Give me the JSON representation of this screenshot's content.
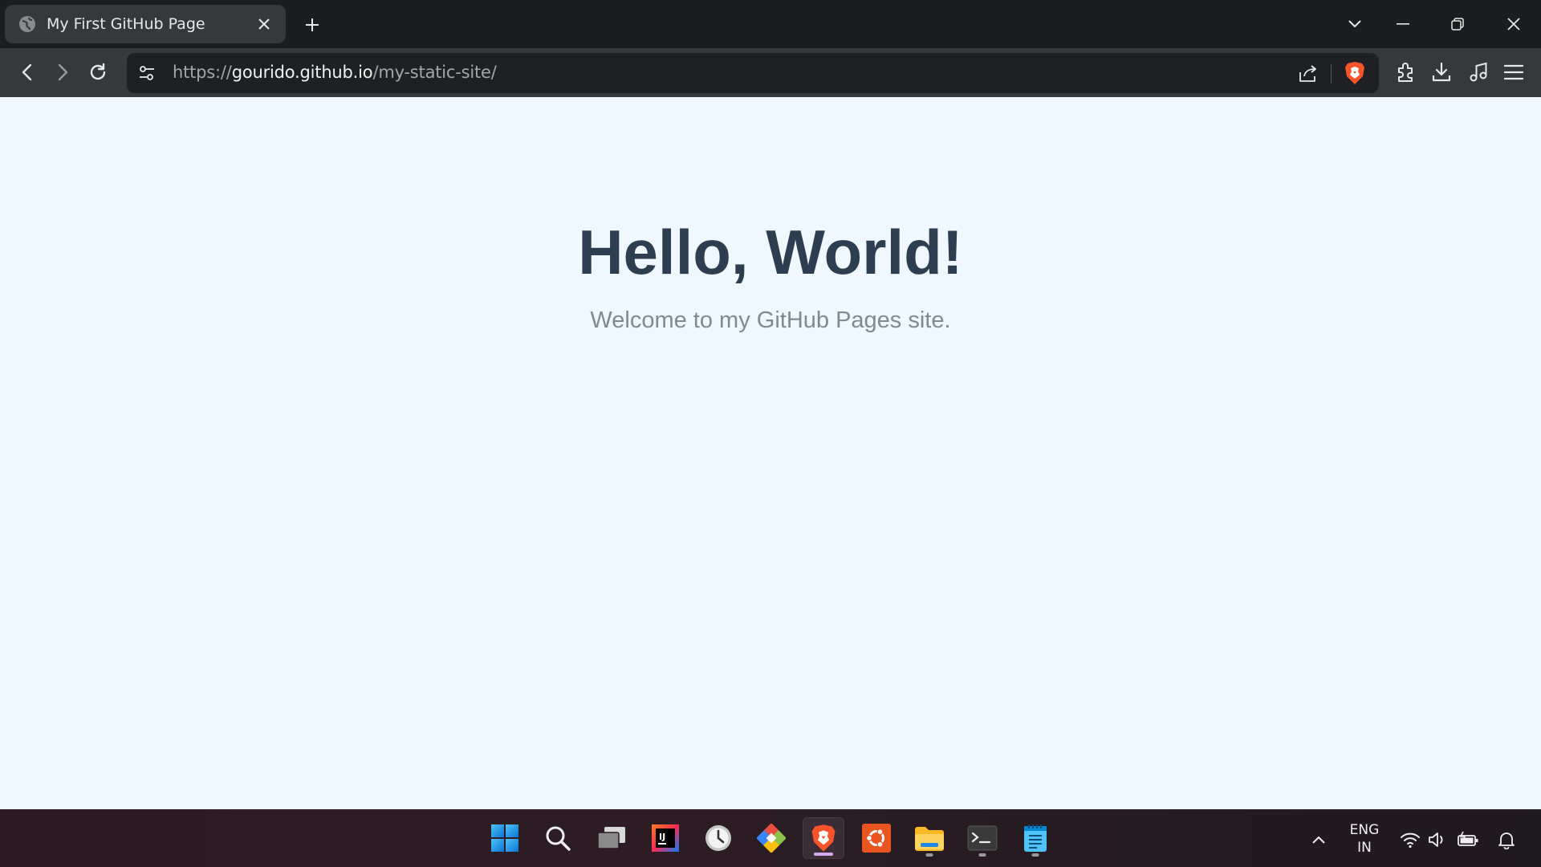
{
  "browser": {
    "tab": {
      "title": "My First GitHub Page",
      "favicon": "globe-icon",
      "close_icon": "close-icon"
    },
    "new_tab_icon": "plus-icon",
    "window_controls": [
      "tab-search-chevron-icon",
      "minimize-icon",
      "restore-icon",
      "close-icon"
    ],
    "address": {
      "scheme": "https://",
      "host": "gourido.github.io",
      "path": "/my-static-site/"
    },
    "toolbar_icons": [
      "back-icon",
      "forward-icon",
      "reload-icon",
      "site-settings-icon",
      "share-icon",
      "brave-shields-icon",
      "extensions-icon",
      "downloads-icon",
      "media-icon",
      "menu-icon"
    ]
  },
  "page": {
    "heading": "Hello, World!",
    "subtitle": "Welcome to my GitHub Pages site.",
    "background": "#eff8fe",
    "heading_color": "#2c3e50",
    "subtitle_color": "#7f8c8d"
  },
  "taskbar": {
    "apps": [
      "windows-start-icon",
      "search-icon",
      "task-view-icon",
      "intellij-icon",
      "clock-icon",
      "git-icon",
      "brave-browser-icon",
      "ubuntu-icon",
      "file-explorer-icon",
      "terminal-icon",
      "notepad-icon"
    ],
    "language": {
      "line1": "ENG",
      "line2": "IN"
    },
    "tray_icons": [
      "show-hidden-icons-chevron",
      "wifi-icon",
      "volume-icon",
      "battery-icon",
      "notification-bell-icon"
    ]
  }
}
